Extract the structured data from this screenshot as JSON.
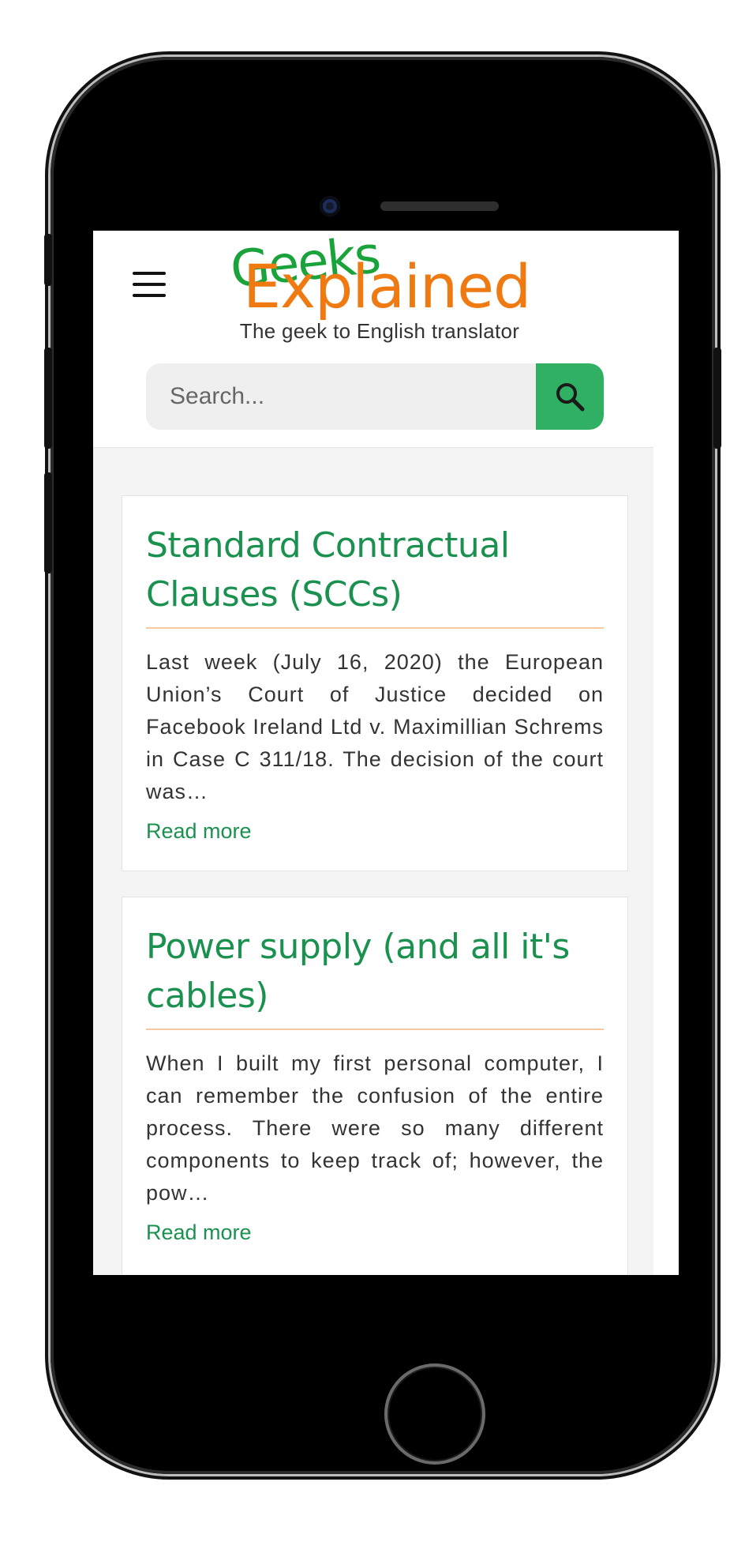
{
  "logo": {
    "word1": "Geeks",
    "word2": "Explained",
    "tagline": "The geek to English translator",
    "colors": {
      "geeks": "#1aa33a",
      "explained": "#ef7a12"
    }
  },
  "search": {
    "placeholder": "Search...",
    "button_icon": "search-icon",
    "button_color": "#2fb062"
  },
  "menu": {
    "icon": "hamburger-menu-icon"
  },
  "articles": [
    {
      "title": "Standard Contractual Clauses (SCCs)",
      "excerpt": "Last week (July 16, 2020) the European Union’s Court of Justice decided on Facebook Ireland Ltd v. Maximillian Schrems in Case C 311/18. The decision of the court was…",
      "read_more": "Read more"
    },
    {
      "title": "Power supply (and all it's cables)",
      "excerpt": "When I built my first personal computer, I can remember the confusion of the entire process. There were so many different components to keep track of; however, the pow…",
      "read_more": "Read more"
    }
  ],
  "theme": {
    "accent": "#1b9150",
    "rule": "#f6c8a0",
    "background": "#f4f4f4"
  }
}
